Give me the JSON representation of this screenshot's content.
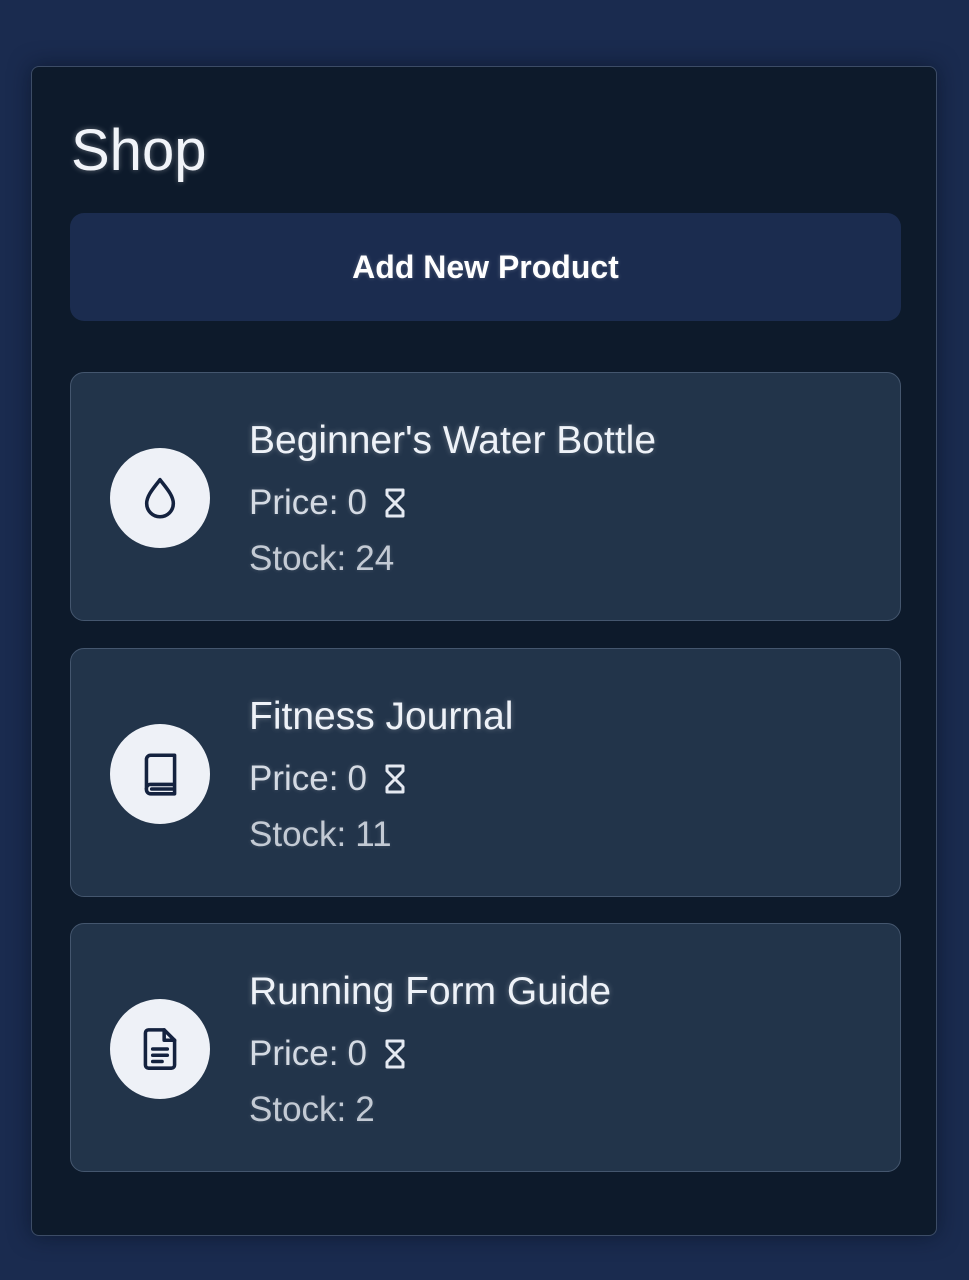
{
  "shop": {
    "title": "Shop",
    "add_button_label": "Add New Product",
    "price_label": "Price:",
    "stock_label": "Stock:",
    "currency_icon": "hourglass-icon",
    "products": [
      {
        "name": "Beginner's Water Bottle",
        "price": "0",
        "stock": "24",
        "icon": "water-drop-icon"
      },
      {
        "name": "Fitness Journal",
        "price": "0",
        "stock": "11",
        "icon": "book-icon"
      },
      {
        "name": "Running Form Guide",
        "price": "0",
        "stock": "2",
        "icon": "document-icon"
      }
    ]
  },
  "colors": {
    "page_background": "#1a2b4f",
    "panel_background": "#0d1a2b",
    "button_background": "#1b2c4f",
    "card_background": "#22344a",
    "icon_circle": "#eef1f7",
    "icon_stroke": "#14223f"
  }
}
